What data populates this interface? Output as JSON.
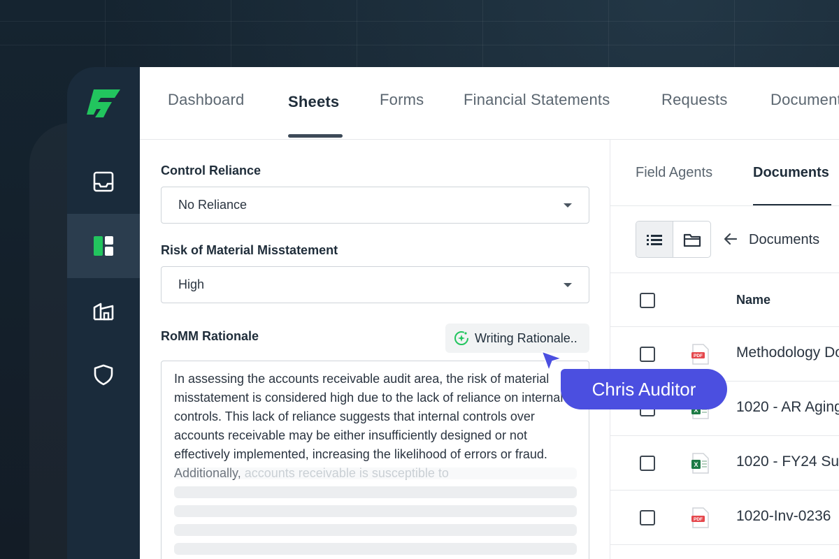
{
  "app": {
    "brand_color": "#22c55e",
    "sidebar_icons": [
      "inbox-icon",
      "sheets-icon",
      "building-icon",
      "shield-icon"
    ]
  },
  "topnav": {
    "tabs": [
      {
        "label": "Dashboard"
      },
      {
        "label": "Sheets"
      },
      {
        "label": "Forms"
      },
      {
        "label": "Financial Statements"
      },
      {
        "label": "Requests"
      },
      {
        "label": "Documents"
      }
    ],
    "active": "Sheets"
  },
  "form": {
    "control_reliance": {
      "label": "Control Reliance",
      "value": "No Reliance"
    },
    "romm": {
      "label": "Risk of Material Misstatement",
      "value": "High"
    },
    "rationale": {
      "label": "RoMM Rationale",
      "ai_button": "Writing Rationale..",
      "text": "In assessing the accounts receivable audit area, the risk of material misstatement is considered high due to the lack of reliance on internal controls. This lack of reliance suggests that internal controls over accounts receivable may be either insufficiently designed or not effectively implemented, increasing the likelihood of errors or fraud. Additionally,",
      "text_fading": "accounts receivable is susceptible to"
    }
  },
  "right": {
    "tabs": [
      {
        "label": "Field Agents"
      },
      {
        "label": "Documents"
      }
    ],
    "active": "Documents",
    "breadcrumb": "Documents",
    "table": {
      "header": "Name",
      "rows": [
        {
          "name": "Methodology Do",
          "type": "pdf"
        },
        {
          "name": "1020 - AR Aging",
          "type": "xls"
        },
        {
          "name": "1020 - FY24 Su",
          "type": "xls"
        },
        {
          "name": "1020-Inv-0236",
          "type": "pdf"
        }
      ]
    }
  },
  "collaborator": {
    "name": "Chris Auditor",
    "color": "#4b4fe0"
  }
}
